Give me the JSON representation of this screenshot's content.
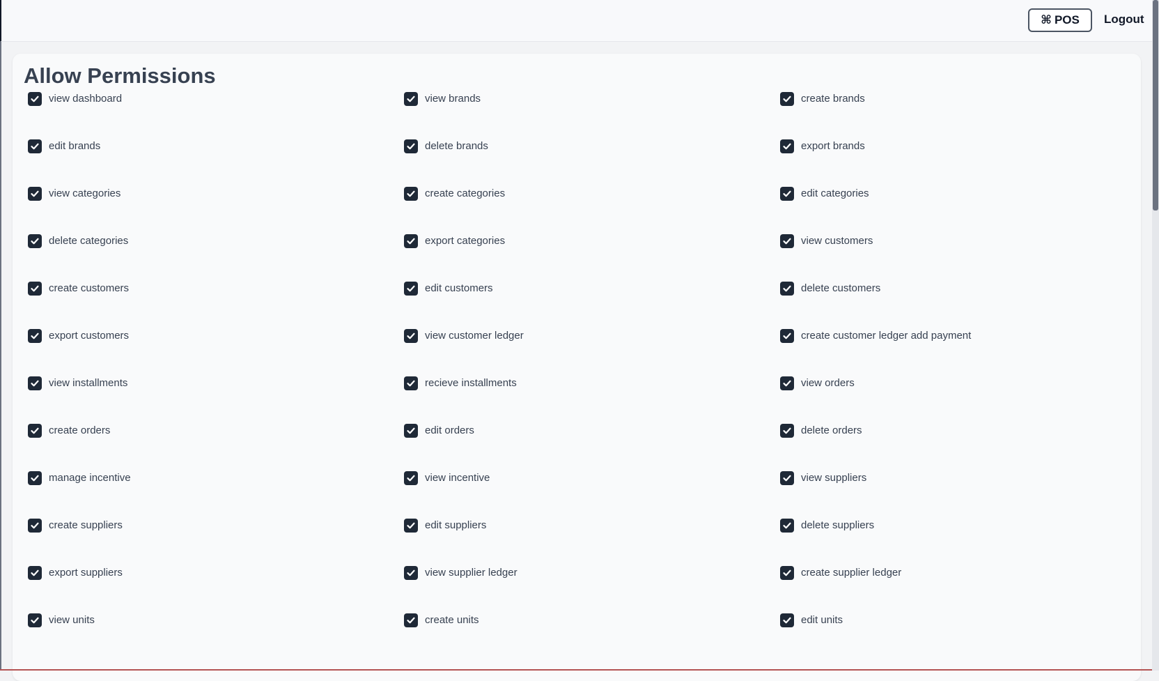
{
  "header": {
    "pos_label": "POS",
    "pos_icon": "command-icon",
    "logout_label": "Logout"
  },
  "main": {
    "title": "Allow Permissions"
  },
  "colors": {
    "checkbox_fill": "#1f2937",
    "check_mark": "#ffffff",
    "card_bg": "#f9fafb",
    "text": "#374151"
  },
  "permissions": [
    {
      "label": "view dashboard",
      "checked": true
    },
    {
      "label": "view brands",
      "checked": true
    },
    {
      "label": "create brands",
      "checked": true
    },
    {
      "label": "edit brands",
      "checked": true
    },
    {
      "label": "delete brands",
      "checked": true
    },
    {
      "label": "export brands",
      "checked": true
    },
    {
      "label": "view categories",
      "checked": true
    },
    {
      "label": "create categories",
      "checked": true
    },
    {
      "label": "edit categories",
      "checked": true
    },
    {
      "label": "delete categories",
      "checked": true
    },
    {
      "label": "export categories",
      "checked": true
    },
    {
      "label": "view customers",
      "checked": true
    },
    {
      "label": "create customers",
      "checked": true
    },
    {
      "label": "edit customers",
      "checked": true
    },
    {
      "label": "delete customers",
      "checked": true
    },
    {
      "label": "export customers",
      "checked": true
    },
    {
      "label": "view customer ledger",
      "checked": true
    },
    {
      "label": "create customer ledger add payment",
      "checked": true
    },
    {
      "label": "view installments",
      "checked": true
    },
    {
      "label": "recieve installments",
      "checked": true
    },
    {
      "label": "view orders",
      "checked": true
    },
    {
      "label": "create orders",
      "checked": true
    },
    {
      "label": "edit orders",
      "checked": true
    },
    {
      "label": "delete orders",
      "checked": true
    },
    {
      "label": "manage incentive",
      "checked": true
    },
    {
      "label": "view incentive",
      "checked": true
    },
    {
      "label": "view suppliers",
      "checked": true
    },
    {
      "label": "create suppliers",
      "checked": true
    },
    {
      "label": "edit suppliers",
      "checked": true
    },
    {
      "label": "delete suppliers",
      "checked": true
    },
    {
      "label": "export suppliers",
      "checked": true
    },
    {
      "label": "view supplier ledger",
      "checked": true
    },
    {
      "label": "create supplier ledger",
      "checked": true
    },
    {
      "label": "view units",
      "checked": true
    },
    {
      "label": "create units",
      "checked": true
    },
    {
      "label": "edit units",
      "checked": true
    }
  ]
}
